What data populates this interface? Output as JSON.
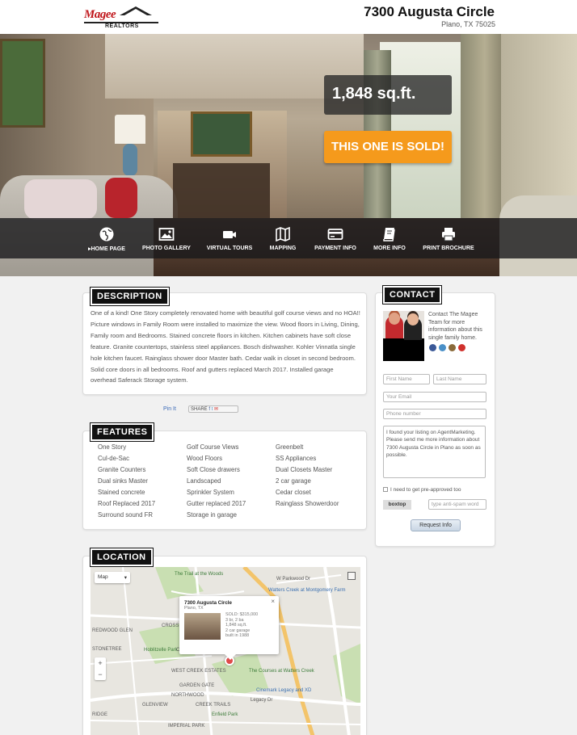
{
  "header": {
    "logo_brand": "Magee",
    "logo_sub": "REALTORS",
    "address_title": "7300 Augusta Circle",
    "address_sub": "Plano, TX 75025"
  },
  "hero": {
    "sqft": "1,848 sq.ft.",
    "sold_label": "THIS ONE IS SOLD!"
  },
  "nav": [
    {
      "label": "▸HOME PAGE",
      "icon": "globe-icon"
    },
    {
      "label": "PHOTO GALLERY",
      "icon": "image-icon"
    },
    {
      "label": "VIRTUAL TOURS",
      "icon": "video-icon"
    },
    {
      "label": "MAPPING",
      "icon": "map-icon"
    },
    {
      "label": "PAYMENT INFO",
      "icon": "credit-card-icon"
    },
    {
      "label": "MORE INFO",
      "icon": "book-icon"
    },
    {
      "label": "PRINT BROCHURE",
      "icon": "printer-icon"
    }
  ],
  "description": {
    "heading": "DESCRIPTION",
    "text": "One of a kind! One Story completely renovated home with beautiful golf course views and no HOA!! Picture windows in Family Room were installed to maximize the view. Wood floors in Living, Dining, Family room and Bedrooms. Stained concrete floors in kitchen. Kitchen cabinets have soft close feature. Granite countertops, stainless steel appliances. Bosch dishwasher. Kohler Vinnatla single hole kitchen faucet. Rainglass shower door Master bath. Cedar walk in closet in second bedroom. Solid core doors in all bedrooms. Roof and gutters replaced March 2017. Installed garage overhead Saferack Storage system."
  },
  "share": {
    "pin_label": "Pin It",
    "share_label": "SHARE"
  },
  "features": {
    "heading": "FEATURES",
    "columns": [
      [
        "One Story",
        "Cul-de-Sac",
        "Granite Counters",
        "Dual sinks Master",
        "Stained concrete",
        "Roof Replaced 2017",
        "Surround sound FR"
      ],
      [
        "Golf Course Views",
        "Wood Floors",
        "Soft Close drawers",
        "Landscaped",
        "Sprinkler System",
        "Gutter replaced 2017",
        "Storage in garage"
      ],
      [
        "Greenbelt",
        "SS Appliances",
        "Dual Closets Master",
        "2 car garage",
        "Cedar closet",
        "Rainglass Showerdoor"
      ]
    ]
  },
  "contact": {
    "heading": "CONTACT",
    "blurb": "Contact The Magee Team for more information about this single family home.",
    "first_name_placeholder": "First Name",
    "last_name_placeholder": "Last Name",
    "email_placeholder": "Your Email",
    "phone_placeholder": "Phone number",
    "message": "I found your listing on AgentMarketing. Please send me more information about 7300 Augusta Circle in Plano as soon as possible.",
    "preapproved_label": "I need to get pre-approved too",
    "captcha_word": "boxtop",
    "antispam_placeholder": "type anti-spam word",
    "submit_label": "Request Info",
    "social_colors": [
      "#3b5998",
      "#4a90c8",
      "#8a6a3a",
      "#d0312d"
    ]
  },
  "location": {
    "heading": "LOCATION",
    "map_type": "Map",
    "popup": {
      "title": "7300 Augusta Circle",
      "city": "Plano, TX",
      "close": "×",
      "details": [
        "SOLD: $315,000",
        "3 br, 2 ba",
        "1,848 sq.ft.",
        "2 car garage",
        "built in 1988"
      ]
    },
    "labels": [
      {
        "text": "The Trail at the Woods",
        "cls": "green"
      },
      {
        "text": "W Parkwood Dr",
        "cls": ""
      },
      {
        "text": "Watters Creek at Montgomery Farm",
        "cls": "blue"
      },
      {
        "text": "REDWOOD GLEN",
        "cls": ""
      },
      {
        "text": "CROSS",
        "cls": ""
      },
      {
        "text": "STONETREE",
        "cls": ""
      },
      {
        "text": "Hoblitzelle Park",
        "cls": "green"
      },
      {
        "text": "CROSS CREEK APARTMENTS",
        "cls": ""
      },
      {
        "text": "CHASE OAKS",
        "cls": ""
      },
      {
        "text": "WEST CREEK ESTATES",
        "cls": ""
      },
      {
        "text": "The Courses at Watters Creek",
        "cls": "green"
      },
      {
        "text": "GARDEN GATE",
        "cls": ""
      },
      {
        "text": "Cinemark Legacy and XD",
        "cls": "blue"
      },
      {
        "text": "NORTHWOOD",
        "cls": ""
      },
      {
        "text": "GLENVIEW",
        "cls": ""
      },
      {
        "text": "CREEK TRAILS",
        "cls": ""
      },
      {
        "text": "RIDGE",
        "cls": ""
      },
      {
        "text": "Enfield Park",
        "cls": "green"
      },
      {
        "text": "IMPERIAL PARK",
        "cls": ""
      },
      {
        "text": "Legacy Dr",
        "cls": ""
      }
    ],
    "zoom_in": "+",
    "zoom_out": "−"
  }
}
